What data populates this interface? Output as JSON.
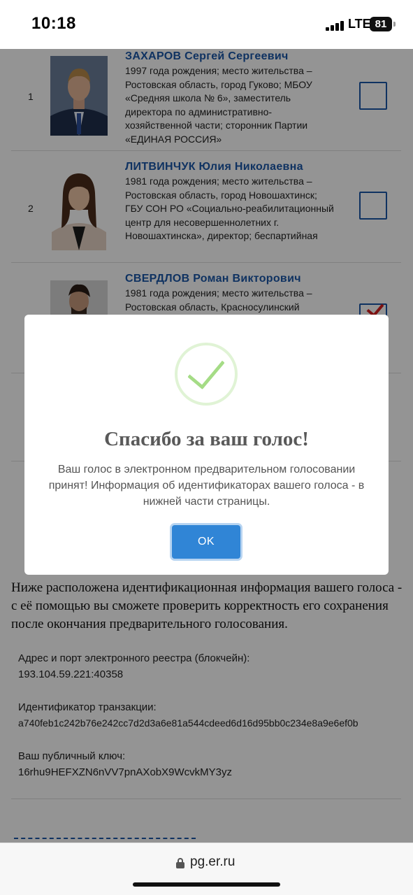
{
  "status_bar": {
    "time": "10:18",
    "network": "LTE",
    "battery": "81"
  },
  "candidates": [
    {
      "number": "1",
      "name": "ЗАХАРОВ Сергей Сергеевич",
      "description": "1997 года рождения; место жительства – Ростовская область, город Гуково; МБОУ «Средняя школа № 6», заместитель директора по административно-хозяйственной части; сторонник Партии «ЕДИНАЯ РОССИЯ»",
      "checked": false
    },
    {
      "number": "2",
      "name": "ЛИТВИНЧУК Юлия Николаевна",
      "description": "1981 года рождения; место жительства – Ростовская область, город Новошахтинск; ГБУ СОН РО «Социально-реабилитационный центр для несовершеннолетних г. Новошахтинска», директор; беспартийная",
      "checked": false
    },
    {
      "number": "",
      "name": "СВЕРДЛОВ Роман Викторович",
      "description": "1981 года рождения; место жительства – Ростовская область, Красносулинский",
      "checked": true
    }
  ],
  "info": {
    "intro": "Ниже расположена идентификационная информация вашего голоса - с её помощью вы сможете проверить корректность его сохранения после окончания предварительного голосования.",
    "registry_label": "Адрес и порт электронного реестра (блокчейн):",
    "registry_value": "193.104.59.221:40358",
    "transaction_label": "Идентификатор транзакции:",
    "transaction_value": "a740feb1c242b76e242cc7d2d3a6e81a544cdeed6d16d95bb0c234e8a9e6ef0b",
    "pubkey_label": "Ваш публичный ключ:",
    "pubkey_value": "16rhu9HEFXZN6nVV7pnAXobX9WcvkMY3yz"
  },
  "modal": {
    "icon": "success-check-icon",
    "title": "Спасибо за ваш голос!",
    "message": "Ваш голос в электронном предварительном голосовании принят! Информация об идентификаторах вашего голоса - в нижней части страницы.",
    "ok_label": "OK"
  },
  "browser": {
    "url": "pg.er.ru"
  },
  "colors": {
    "accent": "#3085d6",
    "candidate_name": "#1a56a8",
    "success": "#a5dc86",
    "check_mark": "#d62020"
  }
}
